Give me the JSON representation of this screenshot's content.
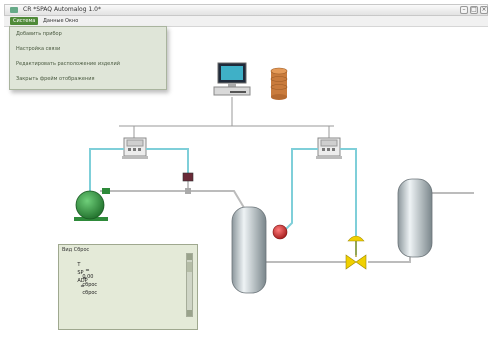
{
  "window": {
    "title": "CR *SPAQ Automalog 1.0*"
  },
  "menubar": {
    "items": [
      "Система",
      "Данные",
      "Окно"
    ],
    "active_index": 0
  },
  "dropdown": {
    "items": [
      "Добавить прибор",
      "Настройка связи",
      "Редактировать расположение изделий",
      "Закрыть фрейм отображения"
    ]
  },
  "panel": {
    "header": "Вид Сброс",
    "rows": [
      {
        "k": "T",
        "op": "=",
        "v": "0.00"
      },
      {
        "k": "SP",
        "op": "=",
        "v": "сброс"
      },
      {
        "k": "ADP",
        "op": "=",
        "v": "сброс"
      }
    ]
  },
  "colors": {
    "pipe_cyan": "#7fcfd9",
    "pipe_gray": "#bcbcbc",
    "pump_green": "#2e8a3a",
    "valve_yellow": "#f0d000",
    "sensor_red": "#d02a2a",
    "menu_accent": "#4f8a38"
  },
  "icons": [
    "computer-icon",
    "database-icon",
    "controller-icon",
    "pump-icon",
    "valve-icon",
    "sensor-icon",
    "tank-icon"
  ]
}
